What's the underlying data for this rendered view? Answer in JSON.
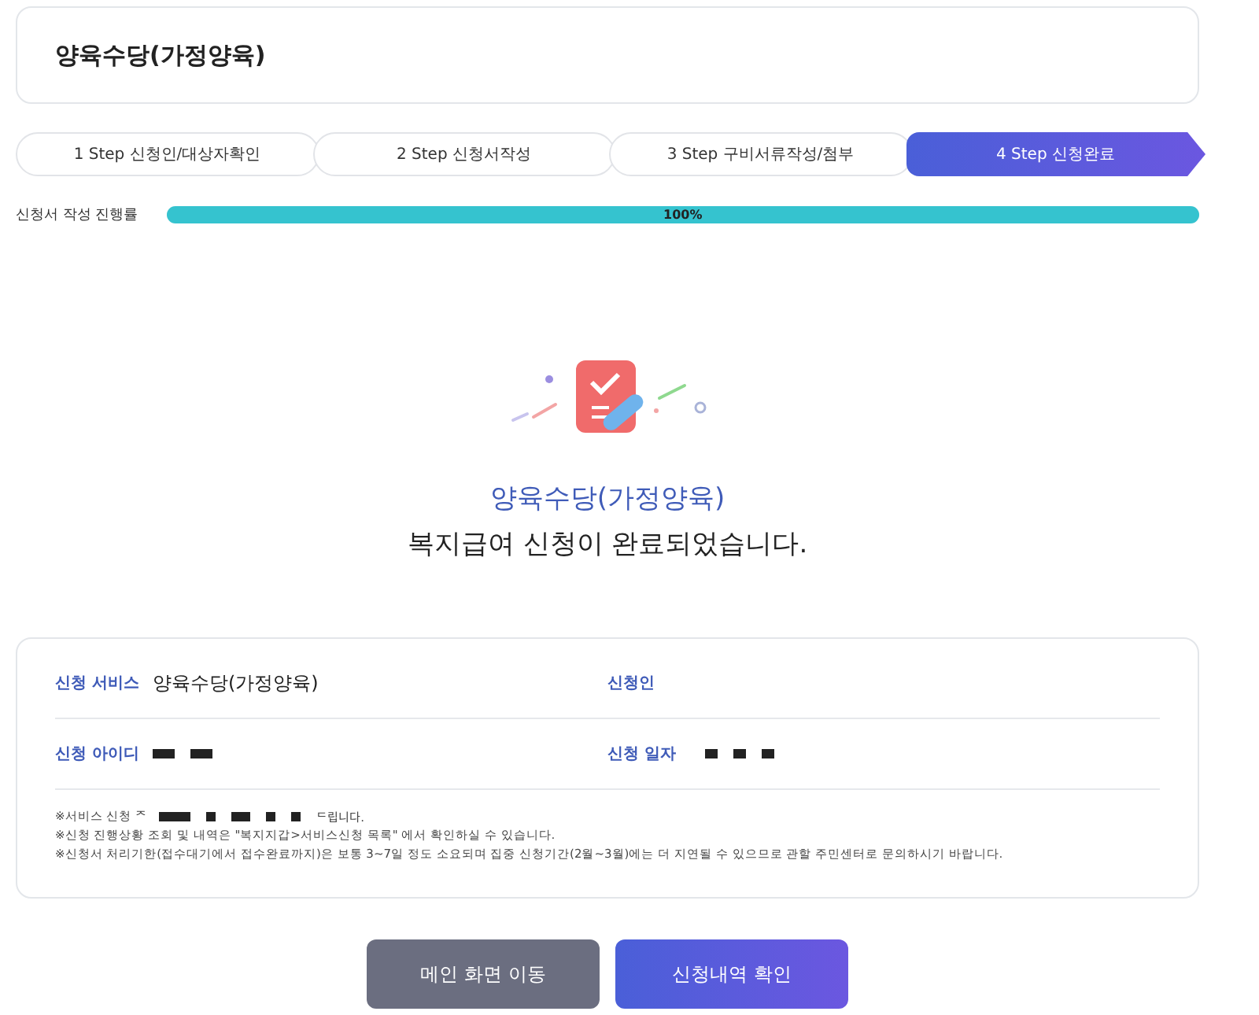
{
  "page_title": "양육수당(가정양육)",
  "steps": [
    {
      "label": "1 Step 신청인/대상자확인",
      "selected": false
    },
    {
      "label": "2 Step 신청서작성",
      "selected": false
    },
    {
      "label": "3 Step 구비서류작성/첨부",
      "selected": false
    },
    {
      "label": "4 Step 신청완료",
      "selected": true
    }
  ],
  "progress": {
    "label": "신청서 작성 진행률",
    "level": 1,
    "reading": "100%"
  },
  "result": {
    "service": "양육수당(가정양육)",
    "message": "복지급여 신청이 완료되었습니다."
  },
  "info_fields": [
    {
      "label": "신청 서비스",
      "kind": "text",
      "value": "양육수당(가정양육)"
    },
    {
      "label": "신청인",
      "kind": "blank"
    },
    {
      "label": "신청 아이디",
      "kind": "redacted"
    },
    {
      "label": "신청 일자",
      "kind": "redacted"
    }
  ],
  "notes": [
    {
      "kind": "redacted",
      "start": "※서비스 신청 ᄌ",
      "end": "ᄃ립니다."
    },
    {
      "kind": "text",
      "text": "※신청 진행상황 조회 및 내역은 \"복지지갑>서비스신청 목록\" 에서 확인하실 수 있습니다."
    },
    {
      "kind": "text",
      "text": "※신청서 처리기한(접수대기에서 접수완료까지)은 보통 3~7일 정도 소요되며 집중 신청기간(2월~3월)에는 더 지연될 수 있으므로 관할 주민센터로 문의하시기 바랍니다."
    }
  ],
  "buttons": [
    {
      "label": "메인 화면 이동",
      "kind": "secondary"
    },
    {
      "label": "신청내역 확인",
      "kind": "primary"
    }
  ]
}
